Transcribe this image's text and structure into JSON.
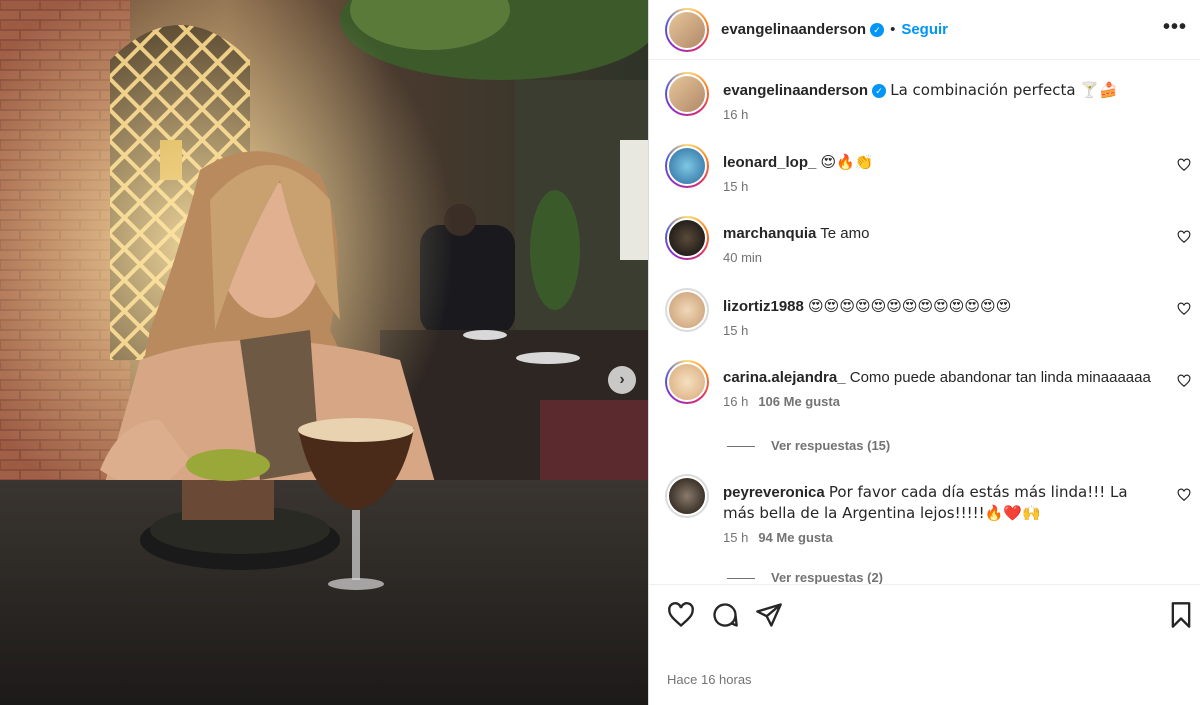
{
  "post": {
    "username": "evangelinaanderson",
    "follow_label": "Seguir",
    "more_label": "•••",
    "next_label": "›",
    "caption": "La combinación perfecta 🍸🍰",
    "caption_time": "16 h",
    "time_ago": "Hace 16 horas"
  },
  "comments": [
    {
      "user": "leonard_lop_",
      "text": "😍🔥👏",
      "time": "15 h",
      "likes": ""
    },
    {
      "user": "marchanquia",
      "text": "Te amo",
      "time": "40 min",
      "likes": ""
    },
    {
      "user": "lizortiz1988",
      "text": "😍😍😍😍😍😍😍😍😍😍😍😍😍",
      "time": "15 h",
      "likes": ""
    },
    {
      "user": "carina.alejandra_",
      "text": "Como puede abandonar tan linda minaaaaaa",
      "time": "16 h",
      "likes": "106 Me gusta",
      "replies": "Ver respuestas (15)"
    },
    {
      "user": "peyreveronica",
      "text": "Por favor cada día estás más linda!!! La más bella de la Argentina lejos!!!!!🔥❤️🙌",
      "time": "15 h",
      "likes": "94 Me gusta",
      "replies": "Ver respuestas (2)"
    }
  ],
  "icons": {
    "verified": "verified-badge-icon",
    "like": "heart-icon",
    "comment": "comment-icon",
    "share": "share-icon",
    "save": "bookmark-icon"
  },
  "colors": {
    "accent": "#0095f6",
    "text": "#262626",
    "muted": "#737373"
  }
}
